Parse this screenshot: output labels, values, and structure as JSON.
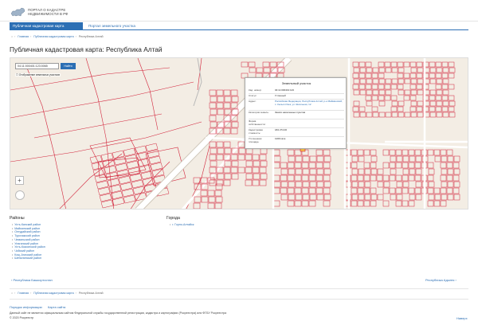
{
  "header": {
    "logo_line1": "ПОРТАЛ О КАДАСТРЕ",
    "logo_line2": "НЕДВИЖИМОСТИ В РФ"
  },
  "tabs": [
    {
      "label": "Публичная кадастровая карта"
    },
    {
      "label": "Портал земельного участка"
    }
  ],
  "breadcrumbs": [
    {
      "label": "Главная"
    },
    {
      "label": "Публичная кадастровая карта"
    },
    {
      "label": "Республика Алтай"
    }
  ],
  "page_title": "Публичная кадастровая карта: Республика Алтай",
  "map": {
    "search_value": "04:11:000401:123:0065",
    "search_button": "Найти",
    "checkbox_label": "Отображение земельных участков",
    "zoom_in": "+",
    "popup": {
      "title": "Земельный участок",
      "rows": [
        {
          "key": "Кад. номер:",
          "value": "04:11:000401:123"
        },
        {
          "key": "Статус:",
          "value": "Учтенный"
        },
        {
          "key": "Адрес:",
          "value": "Российская Федерация, Республика Алтай, р-н Майминский, с. Кызыл-Озек, ул. Школьная, 12"
        },
        {
          "key": "Категория земель:",
          "value": "Земли населенных пунктов"
        },
        {
          "key": "Форма собственности:",
          "value": ""
        },
        {
          "key": "Кадастровая стоимость:",
          "value": "184 274.00"
        },
        {
          "key": "Уточненная площадь:",
          "value": "1200 кв.м"
        }
      ]
    },
    "colors": {
      "background": "#f3ede4",
      "parcel_stroke": "#d2243b",
      "road": "#ffffff",
      "road_edge": "#cfc7ba",
      "label": "#6b5f52"
    }
  },
  "regions": {
    "title": "Районы",
    "items": [
      "Усть-Канский район",
      "Майминский район",
      "Онгудайский район",
      "Турочакский район",
      "Чемальский район",
      "Улаганский район",
      "Усть-Коксинский район",
      "Чойский район",
      "Кош-Агачский район",
      "Шебалинский район"
    ]
  },
  "cities": {
    "title": "Города",
    "items": [
      "г. Горно-Алтайск"
    ]
  },
  "pager": {
    "prev": "Республика Башкортостан",
    "next": "Республика Адыгея"
  },
  "footer": {
    "links": [
      "Порядок информации",
      "Карта сайта"
    ],
    "line1": "Данный сайт не является официальным сайтом Федеральной службы государственной регистрации, кадастра и картографии (Росреестра) или ФГБУ Росреестра",
    "line2": "© 2020 Росреестр",
    "top_link": "Наверх"
  }
}
